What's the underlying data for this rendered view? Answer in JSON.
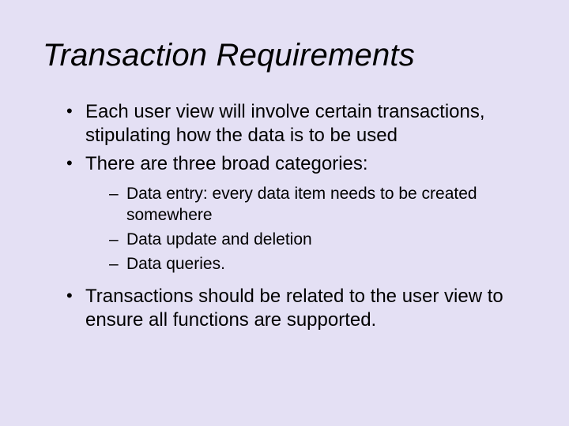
{
  "title": "Transaction Requirements",
  "bullets": {
    "b1": "Each user view will involve certain transactions, stipulating how the data is to be used",
    "b2": "There are three broad categories:",
    "sub": {
      "s1": "Data entry: every data item needs to be created somewhere",
      "s2": "Data update and deletion",
      "s3": "Data queries."
    },
    "b3": "Transactions should be related to the user view to ensure all functions are supported."
  }
}
